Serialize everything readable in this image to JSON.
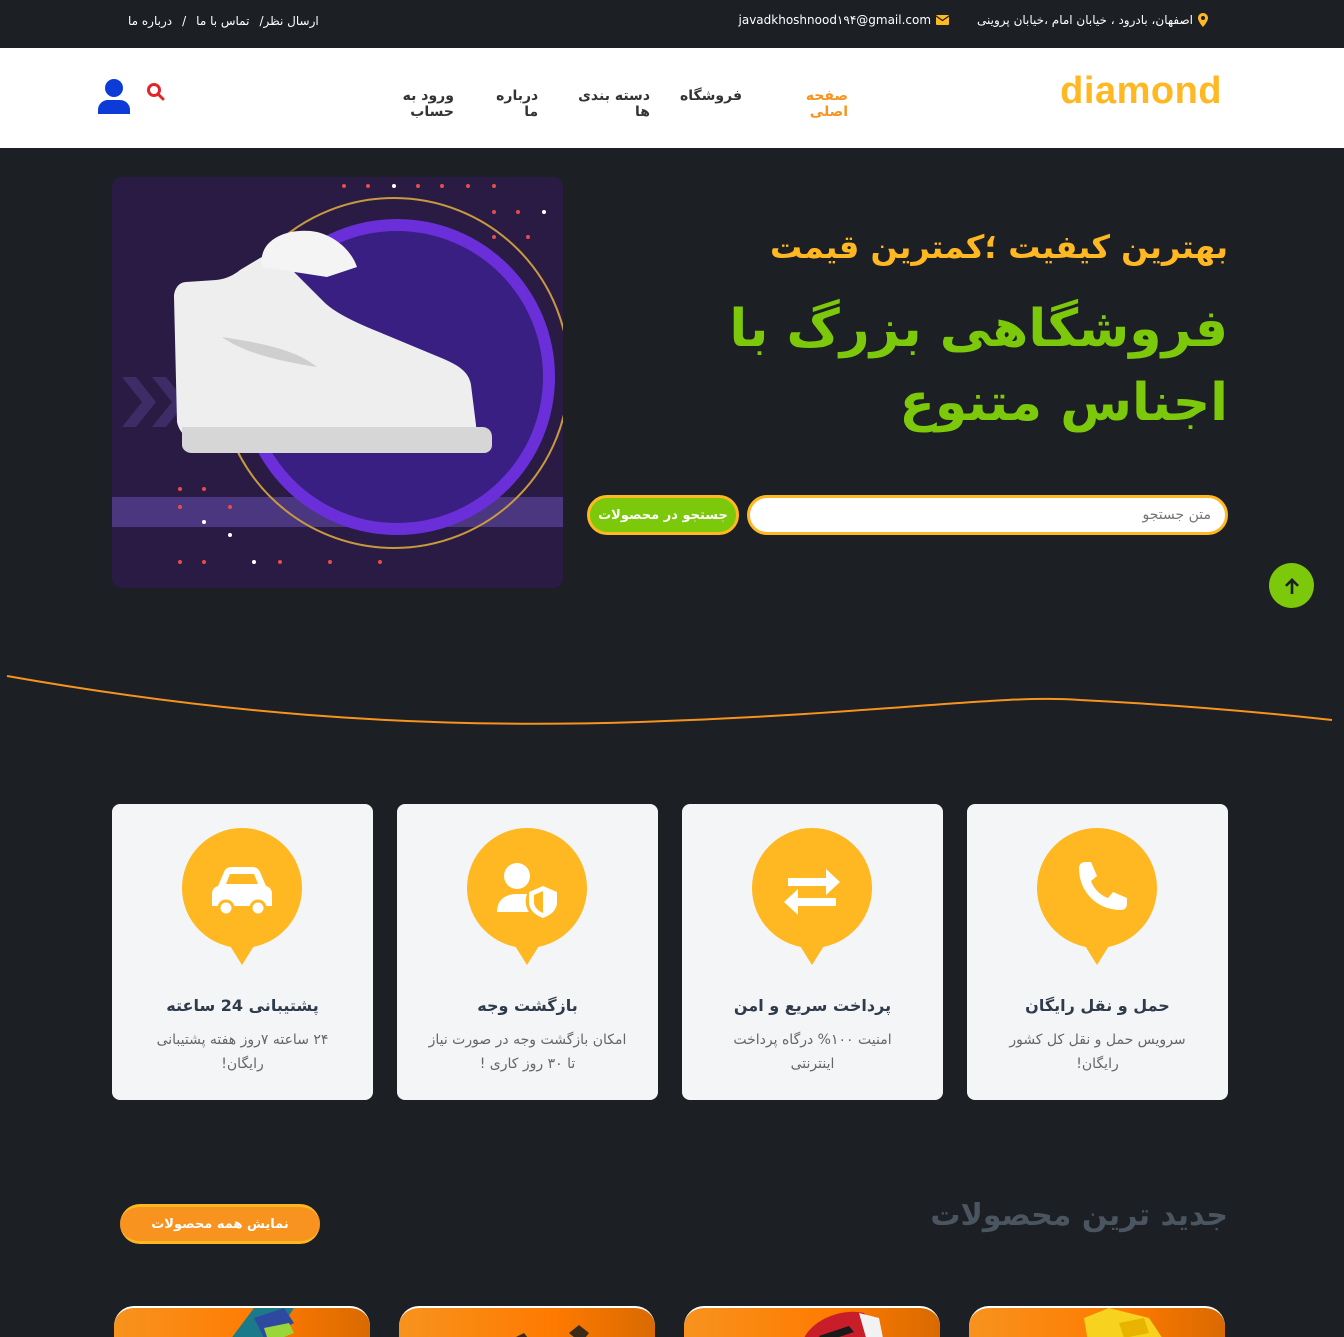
{
  "topbar": {
    "address": "اصفهان، بادرود ، خیابان امام ،خیابان پروینی",
    "email": "javadkhoshnood۱۹۴@gmail.com",
    "links": [
      "درباره ما",
      "/",
      "تماس با ما",
      "/ارسال نظر"
    ]
  },
  "header": {
    "logo": "diamond",
    "nav": [
      "صفحه اصلی",
      "فروشگاه",
      "دسته بندی ها",
      "درباره ما",
      "ورود به حساب"
    ],
    "search_icon": "search-icon",
    "user_icon": "user-icon"
  },
  "hero": {
    "subtitle": "بهترین کیفیت ؛کمترین قیمت",
    "title": "فروشگاهی بزرگ با اجناس متنوع",
    "search_placeholder": "متن جستجو",
    "search_button": "جستجو در محصولات"
  },
  "features": [
    {
      "title": "حمل و نقل رایگان",
      "desc": "سرویس حمل و نقل کل کشور رایگان!",
      "icon": "phone-icon"
    },
    {
      "title": "پرداخت سریع و امن",
      "desc": "امنیت ۱۰۰% درگاه پرداخت اینترنتی",
      "icon": "exchange-icon"
    },
    {
      "title": "بازگشت وجه",
      "desc": "امکان بازگشت وجه در صورت نیاز تا ۳۰ روز کاری !",
      "icon": "user-shield-icon"
    },
    {
      "title": "پشتیبانی 24 ساعته",
      "desc": "۲۴ ساعته ۷روز هفته پشتیبانی رایگان!",
      "icon": "car-icon"
    }
  ],
  "newest": {
    "title": "جدید ترین محصولات",
    "all_button": "نمایش همه محصولات"
  },
  "colors": {
    "accent_yellow": "#ffb822",
    "accent_green": "#7cc80a",
    "accent_orange": "#f7931e",
    "dark_bg": "#1c1f24"
  }
}
